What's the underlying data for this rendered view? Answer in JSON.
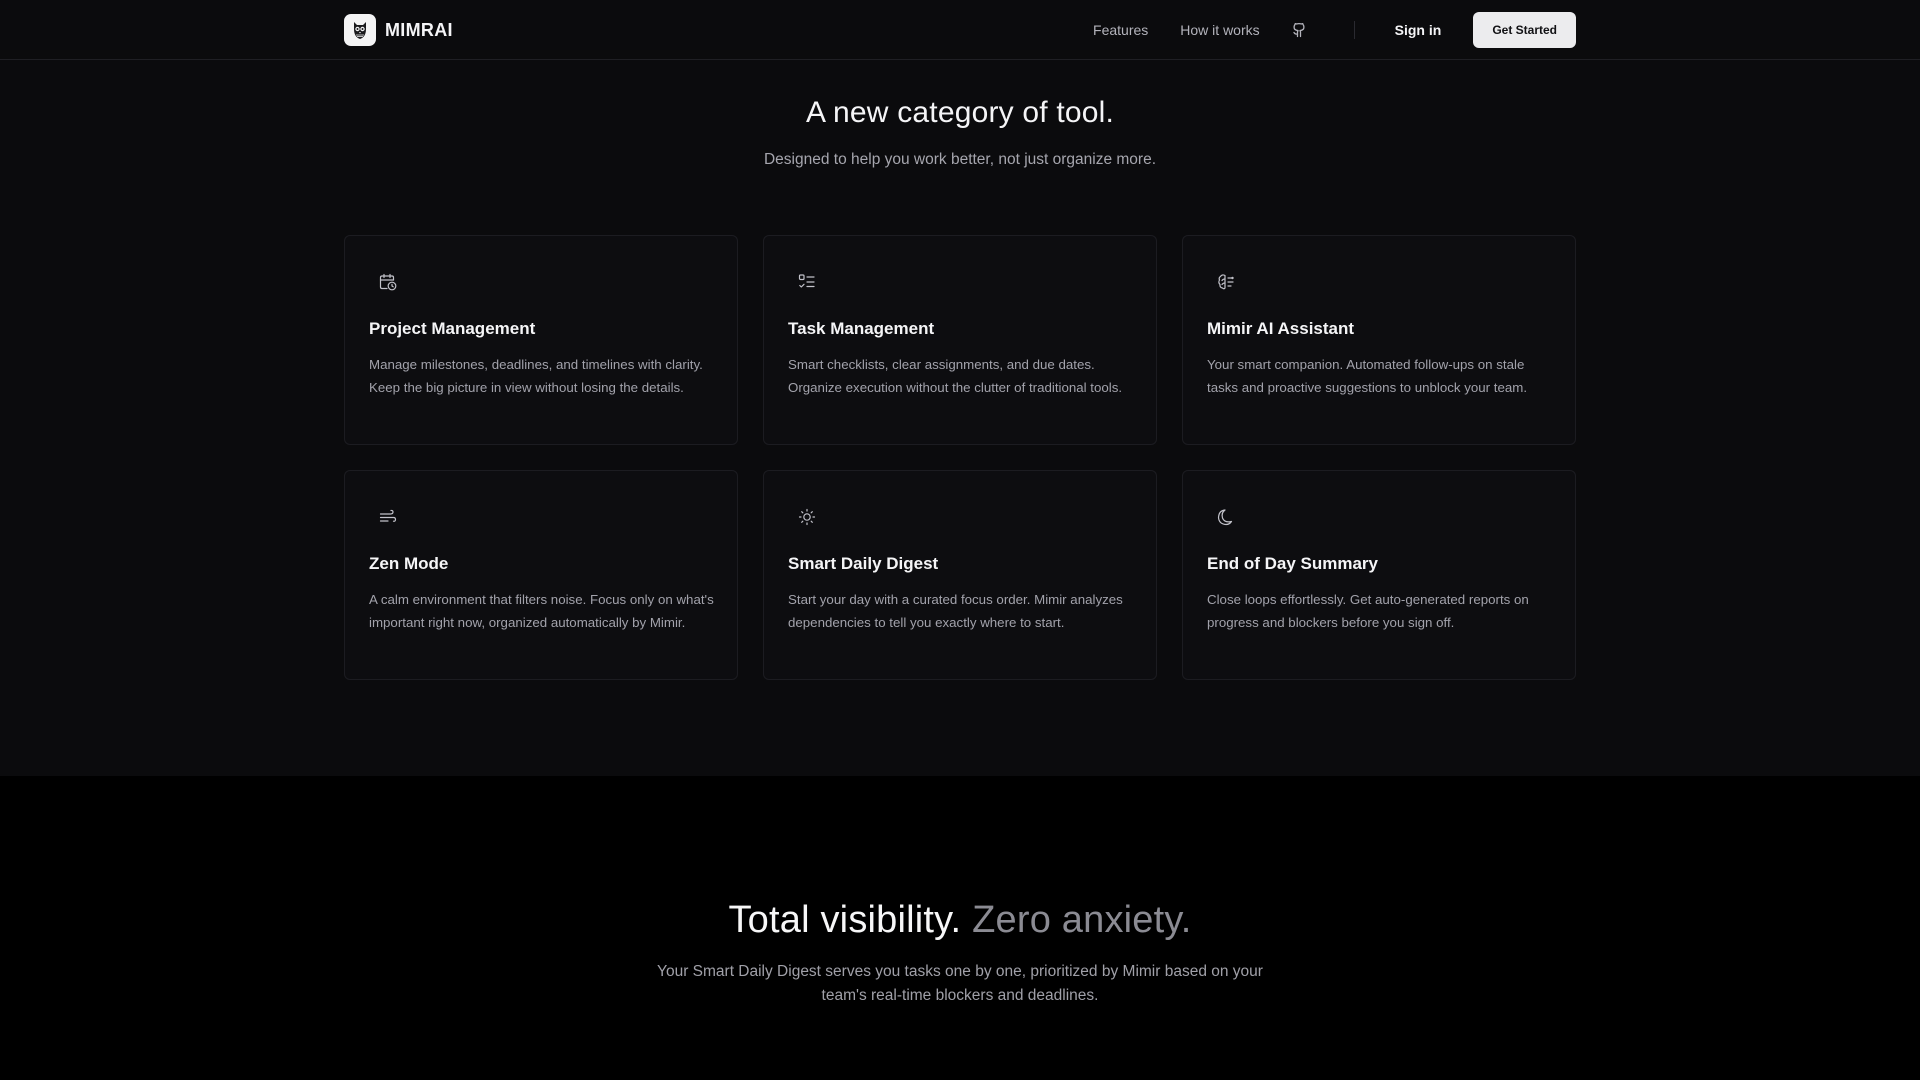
{
  "brand": {
    "name": "MIMRAI",
    "logo_icon": "owl-logo-icon"
  },
  "nav": {
    "links": [
      "Features",
      "How it works"
    ],
    "github_icon": "github-icon",
    "sign_in": "Sign in",
    "cta": "Get Started"
  },
  "features": {
    "title": "A new category of tool.",
    "subtitle": "Designed to help you work better, not just organize more.",
    "cards": [
      {
        "icon": "calendar-clock-icon",
        "title": "Project Management",
        "desc": "Manage milestones, deadlines, and timelines with clarity. Keep the big picture in view without losing the details."
      },
      {
        "icon": "list-checks-icon",
        "title": "Task Management",
        "desc": "Smart checklists, clear assignments, and due dates. Organize execution without the clutter of traditional tools."
      },
      {
        "icon": "brain-icon",
        "title": "Mimir AI Assistant",
        "desc": "Your smart companion. Automated follow-ups on stale tasks and proactive suggestions to unblock your team."
      },
      {
        "icon": "wind-icon",
        "title": "Zen Mode",
        "desc": "A calm environment that filters noise. Focus only on what's important right now, organized automatically by Mimir."
      },
      {
        "icon": "sun-icon",
        "title": "Smart Daily Digest",
        "desc": "Start your day with a curated focus order. Mimir analyzes dependencies to tell you exactly where to start."
      },
      {
        "icon": "moon-icon",
        "title": "End of Day Summary",
        "desc": "Close loops effortlessly. Get auto-generated reports on progress and blockers before you sign off."
      }
    ]
  },
  "visibility": {
    "title_strong": "Total visibility.",
    "title_muted": "Zero anxiety.",
    "subtitle": "Your Smart Daily Digest serves you tasks one by one, prioritized by Mimir based on your team's real-time blockers and deadlines."
  },
  "colors": {
    "background": "#0b0b0d",
    "lower_background": "#000000",
    "cta_bg": "#ececee",
    "muted_text": "#a2a2ab"
  }
}
